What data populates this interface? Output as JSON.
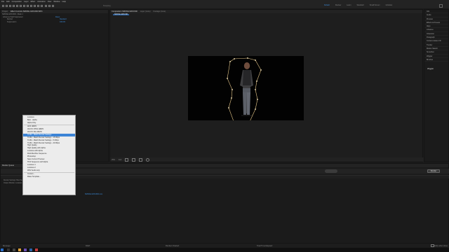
{
  "menubar": [
    "File",
    "Edit",
    "Composition",
    "Layer",
    "Effect",
    "Animation",
    "View",
    "Window",
    "Help"
  ],
  "toolbar": {
    "snapping_label": "Snapping",
    "workspaces": [
      {
        "label": "Default",
        "active": true
      },
      {
        "label": "Review",
        "active": false
      },
      {
        "label": "Learn",
        "active": false
      },
      {
        "label": "Standard",
        "active": false
      },
      {
        "label": "Small Screen",
        "active": false
      },
      {
        "label": "Libraries",
        "active": false
      }
    ]
  },
  "left_panel": {
    "tabs": [
      "Project",
      "Effect Controls SMOKE.GROUND.MP4"
    ],
    "subheader": "SMOKE.GROUND • Mask 1",
    "rows": [
      {
        "label": "Advanced Spill Suppressor",
        "value": "Reset"
      },
      {
        "label": "Method",
        "value": "Standard"
      },
      {
        "label": "Suppression",
        "value": "100.0%"
      }
    ]
  },
  "viewer": {
    "tabs": [
      "Composition SMOKE.GROUND",
      "Layer (none)",
      "Footage (none)"
    ],
    "comp_tab": "SMOKE.GROUND",
    "zoom": "25%",
    "quality": "Full"
  },
  "right_panel": {
    "items": [
      "Info",
      "Audio",
      "Preview",
      "Effects & Presets",
      "Align",
      "Libraries",
      "Character",
      "Paragraph",
      "Content-Aware Fill",
      "Tracker",
      "Motion Sketch",
      "Smoother",
      "Wiggler",
      "Brushes"
    ],
    "section": "Wiggler"
  },
  "render_queue": {
    "tab": "Render Queue",
    "render_button": "Render",
    "rows": [
      "Render Settings: Best Settings",
      "Output Module: Lossless"
    ],
    "output_to": "SMOKE.GROUND.mov"
  },
  "context_menu": {
    "items": [
      {
        "label": "Lossless",
        "selected": false
      },
      {
        "label": "Bam - Alpha",
        "selected": false
      },
      {
        "label": "Alpha Only",
        "selected": false
      },
      {
        "label": "AIFF 48kHz",
        "selected": false
      },
      {
        "label": "AVI DV NTSC 48kHz",
        "selected": false
      },
      {
        "label": "AVI DV PAL 48kHz",
        "selected": false
      },
      {
        "label": "H.264 - Match Render Settings",
        "selected": true
      },
      {
        "label": "H.264 - Match Render Settings - 15 Mbps",
        "selected": false
      },
      {
        "label": "H.264 - Match Render Settings - 5 Mbps",
        "selected": false
      },
      {
        "label": "H.264 - Match Render Settings - 40 Mbps",
        "selected": false
      },
      {
        "label": "High Quality",
        "selected": false
      },
      {
        "label": "High Quality with Alpha",
        "selected": false
      },
      {
        "label": "Lossless with Alpha",
        "selected": false
      },
      {
        "label": "Multi-Machine Sequence",
        "selected": false
      },
      {
        "label": "Photoshop",
        "selected": false
      },
      {
        "label": "Save Current Preview",
        "selected": false
      },
      {
        "label": "TIFF Sequence with Alpha",
        "selected": false
      },
      {
        "label": "Lossless 1",
        "selected": false
      },
      {
        "label": "Lossless 2",
        "selected": false
      },
      {
        "label": "WAV Audio only",
        "selected": false
      },
      {
        "label": "Custom...",
        "selected": false
      },
      {
        "label": "Make Template...",
        "selected": false
      }
    ]
  },
  "status_bar": {
    "message_label": "Message:",
    "ram_label": "RAM:",
    "renders_started_label": "Renders Started:",
    "total_time_label": "Total Time Elapsed:",
    "notify_label": "Notify when done"
  },
  "colors": {
    "accent": "#3d8fe0",
    "mask": "#e8c98a",
    "menu_selected": "#3c84d6"
  }
}
